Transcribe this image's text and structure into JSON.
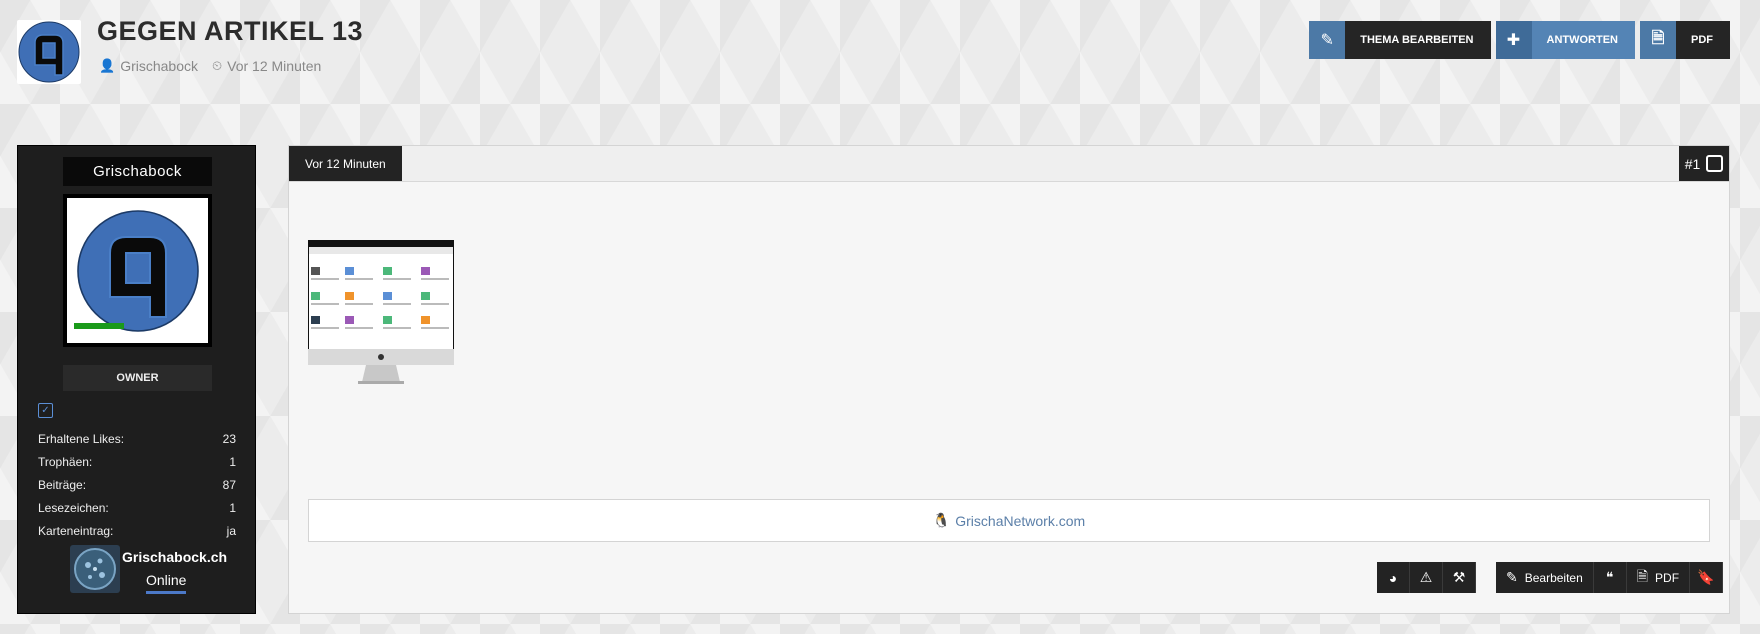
{
  "header": {
    "title": "GEGEN ARTIKEL 13",
    "author": "Grischabock",
    "time": "Vor 12 Minuten",
    "logo_icon": "grisch-logo-icon"
  },
  "top_buttons": {
    "edit_label": "THEMA BEARBEITEN",
    "reply_label": "ANTWORTEN",
    "pdf_label": "PDF"
  },
  "sidebar": {
    "username": "Grischabock",
    "rank": "OWNER",
    "stats": [
      {
        "label": "Erhaltene Likes:",
        "value": "23"
      },
      {
        "label": "Trophäen:",
        "value": "1"
      },
      {
        "label": "Beiträge:",
        "value": "87"
      },
      {
        "label": "Lesezeichen:",
        "value": "1"
      },
      {
        "label": "Karteneintrag:",
        "value": "ja"
      }
    ],
    "site_name": "Grischabock.ch",
    "site_status": "Online"
  },
  "post": {
    "time_tab": "Vor 12 Minuten",
    "number": "#1",
    "signature_text": "GrischaNetwork.com",
    "actions": {
      "edit_label": "Bearbeiten",
      "pdf_label": "PDF"
    }
  },
  "colors": {
    "accent": "#4c79a6",
    "dark": "#232323",
    "online": "#1a9a1a"
  }
}
